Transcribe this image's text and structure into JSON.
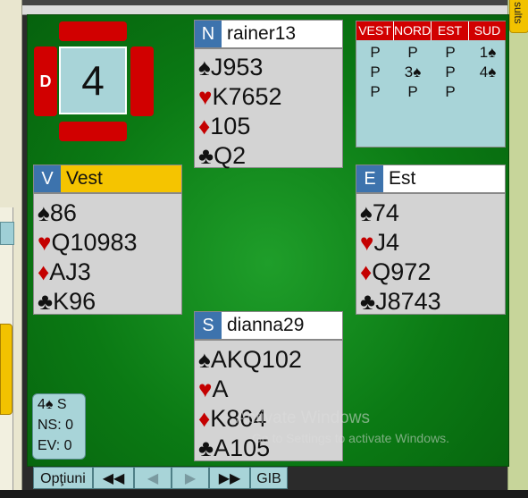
{
  "board": {
    "number": "4",
    "dealer": "D"
  },
  "colors": {
    "felt": "#0b7a14",
    "vulnerable_red": "#d10000",
    "seat_blue": "#3d73ad",
    "turn_yellow": "#f5c400",
    "panel_teal": "#a8d4d8"
  },
  "tabs": {
    "results_label": "sults"
  },
  "hands": {
    "north": {
      "seat": "N",
      "player": "rainer13",
      "spades": "J953",
      "hearts": "K7652",
      "diamonds": "105",
      "clubs": "Q2"
    },
    "west": {
      "seat": "V",
      "player": "Vest",
      "spades": "86",
      "hearts": "Q10983",
      "diamonds": "AJ3",
      "clubs": "K96"
    },
    "east": {
      "seat": "E",
      "player": "Est",
      "spades": "74",
      "hearts": "J4",
      "diamonds": "Q972",
      "clubs": "J8743"
    },
    "south": {
      "seat": "S",
      "player": "dianna29",
      "spades": "AKQ102",
      "hearts": "A",
      "diamonds": "K864",
      "clubs": "A105"
    }
  },
  "suit_symbols": {
    "spades": "♠",
    "hearts": "♥",
    "diamonds": "♦",
    "clubs": "♣"
  },
  "bidding": {
    "headers": [
      "VEST",
      "NORD",
      "EST",
      "SUD"
    ],
    "rows": [
      [
        "P",
        "P",
        "P",
        "1♠"
      ],
      [
        "P",
        "3♠",
        "P",
        "4♠"
      ],
      [
        "P",
        "P",
        "P",
        ""
      ]
    ]
  },
  "score": {
    "contract": "4♠ S",
    "ns": "NS: 0",
    "ev": "EV: 0"
  },
  "nav": {
    "options": "Opţiuni",
    "first": "◀◀",
    "prev": "◀",
    "next": "▶",
    "last": "▶▶",
    "gib": "GIB"
  },
  "watermark": {
    "title": "Activate Windows",
    "subtitle": "Go to Settings to activate Windows."
  }
}
